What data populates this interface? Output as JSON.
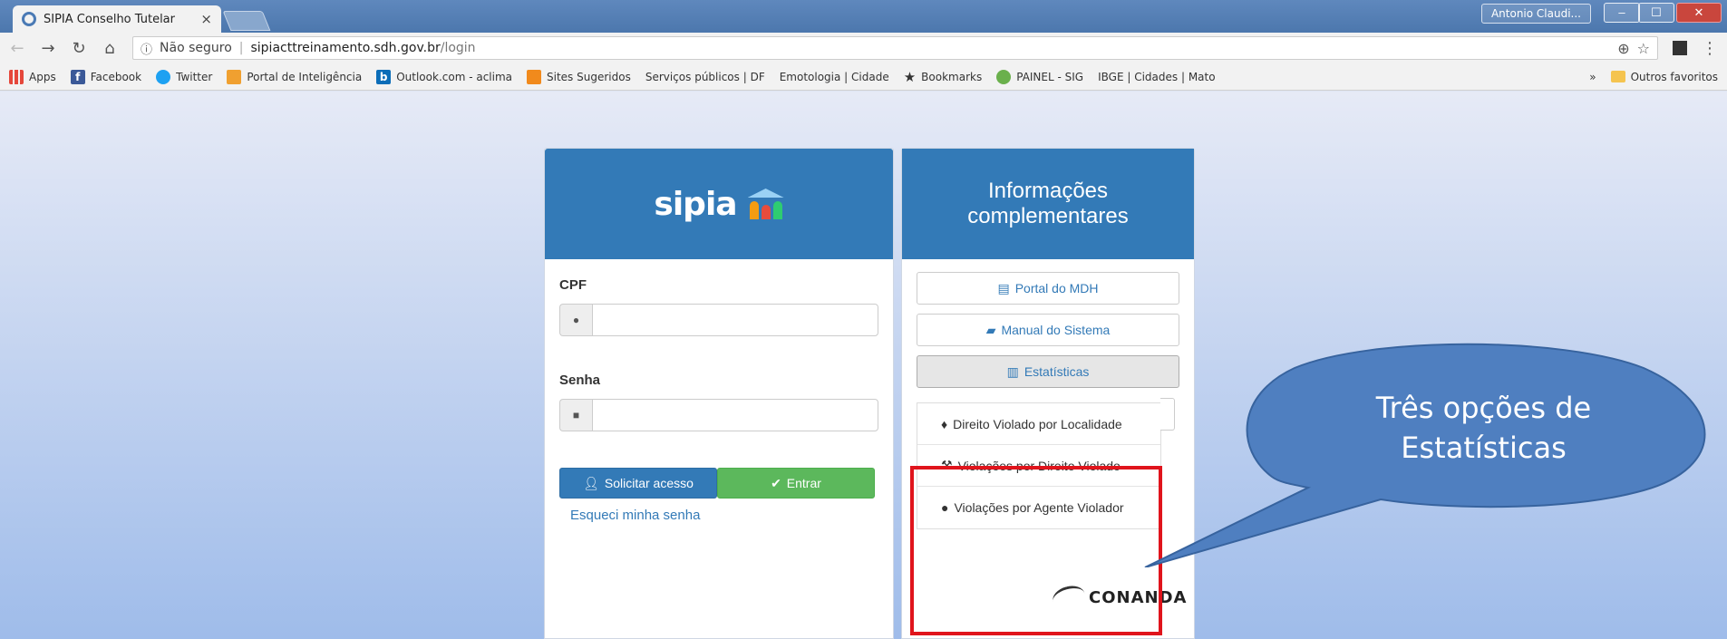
{
  "browser": {
    "tab_title": "SIPIA Conselho Tutelar",
    "tab_close": "×",
    "profile_name": "Antonio Claudi...",
    "security_label": "Não seguro",
    "url_host": "sipiacttreinamento.sdh.gov.br",
    "url_path": "/login",
    "bookmarks": [
      {
        "label": "Apps",
        "icon": "apps-grid-icon"
      },
      {
        "label": "Facebook",
        "icon": "facebook-icon"
      },
      {
        "label": "Twitter",
        "icon": "twitter-icon"
      },
      {
        "label": "Portal de Inteligência",
        "icon": "portal-icon"
      },
      {
        "label": "Outlook.com - aclima",
        "icon": "bing-icon"
      },
      {
        "label": "Sites Sugeridos",
        "icon": "sites-icon"
      },
      {
        "label": "Serviços públicos | DF",
        "icon": "page-icon"
      },
      {
        "label": "Emotologia | Cidade",
        "icon": "page-icon"
      },
      {
        "label": "Bookmarks",
        "icon": "star-icon"
      },
      {
        "label": "PAINEL - SIG",
        "icon": "painel-icon"
      },
      {
        "label": "IBGE | Cidades | Mato",
        "icon": "page-icon"
      }
    ],
    "bookmarks_more": "»",
    "other_bookmarks": "Outros favoritos"
  },
  "login": {
    "logo_text": "sipia",
    "cpf_label": "CPF",
    "cpf_value": "",
    "senha_label": "Senha",
    "senha_value": "",
    "request_access_label": "Solicitar acesso",
    "enter_label": "Entrar",
    "forgot_label": "Esqueci minha senha"
  },
  "info": {
    "title": "Informações complementares",
    "buttons": [
      {
        "label": "Portal do MDH",
        "icon": "newspaper-icon"
      },
      {
        "label": "Manual do Sistema",
        "icon": "book-icon"
      },
      {
        "label": "Estatísticas",
        "icon": "bar-chart-icon"
      }
    ],
    "stats_menu": [
      {
        "label": "Direito Violado por Localidade",
        "icon": "map-marker-icon"
      },
      {
        "label": "Violações por Direito Violado",
        "icon": "gavel-icon"
      },
      {
        "label": "Violações por Agente Violador",
        "icon": "user-icon"
      }
    ],
    "partner_logo": "CONANDA"
  },
  "callout": {
    "line1": "Três opções de",
    "line2": "Estatísticas"
  },
  "colors": {
    "primary": "#337ab7",
    "success": "#5cb85c",
    "highlight": "#e0141c",
    "callout_fill": "#4f7fc0"
  }
}
